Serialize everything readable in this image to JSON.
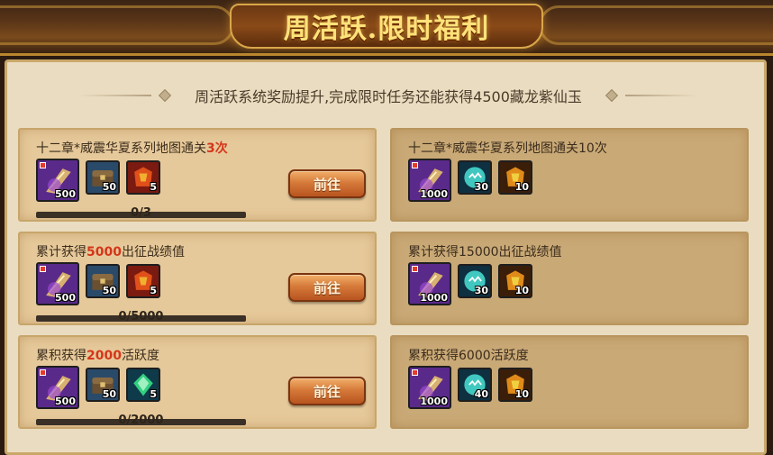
{
  "header": {
    "title": "周活跃.限时福利"
  },
  "subtitle": "周活跃系统奖励提升,完成限时任务还能获得4500藏龙紫仙玉",
  "go_label": "前往",
  "left_cards": [
    {
      "title_prefix": "十二章*威震华夏系列地图通关",
      "title_highlight": "3次",
      "title_suffix": "",
      "items": [
        {
          "icon": "purple-horn-icon",
          "count": "500"
        },
        {
          "icon": "chest-icon",
          "count": "50"
        },
        {
          "icon": "red-armor-icon",
          "count": "5"
        }
      ],
      "progress": "0/3",
      "progress_fraction": 0
    },
    {
      "title_prefix": "累计获得",
      "title_highlight": "5000",
      "title_suffix": "出征战绩值",
      "items": [
        {
          "icon": "purple-horn-icon",
          "count": "500"
        },
        {
          "icon": "chest-icon",
          "count": "50"
        },
        {
          "icon": "red-armor-icon",
          "count": "5"
        }
      ],
      "progress": "0/5000",
      "progress_fraction": 0
    },
    {
      "title_prefix": "累积获得",
      "title_highlight": "2000",
      "title_suffix": "活跃度",
      "items": [
        {
          "icon": "purple-horn-icon",
          "count": "500"
        },
        {
          "icon": "chest-icon",
          "count": "50"
        },
        {
          "icon": "green-gem-icon",
          "count": "5"
        }
      ],
      "progress": "0/2000",
      "progress_fraction": 0
    }
  ],
  "right_cards": [
    {
      "title": "十二章*威震华夏系列地图通关10次",
      "items": [
        {
          "icon": "purple-horn-icon",
          "count": "1000"
        },
        {
          "icon": "teal-orb-icon",
          "count": "30"
        },
        {
          "icon": "gold-armor-icon",
          "count": "10"
        }
      ]
    },
    {
      "title": "累计获得15000出征战绩值",
      "items": [
        {
          "icon": "purple-horn-icon",
          "count": "1000"
        },
        {
          "icon": "teal-orb-icon",
          "count": "30"
        },
        {
          "icon": "gold-armor-icon",
          "count": "10"
        }
      ]
    },
    {
      "title": "累积获得6000活跃度",
      "items": [
        {
          "icon": "purple-horn-icon",
          "count": "1000"
        },
        {
          "icon": "teal-orb-icon",
          "count": "40"
        },
        {
          "icon": "gold-armor-icon",
          "count": "10"
        }
      ]
    }
  ]
}
